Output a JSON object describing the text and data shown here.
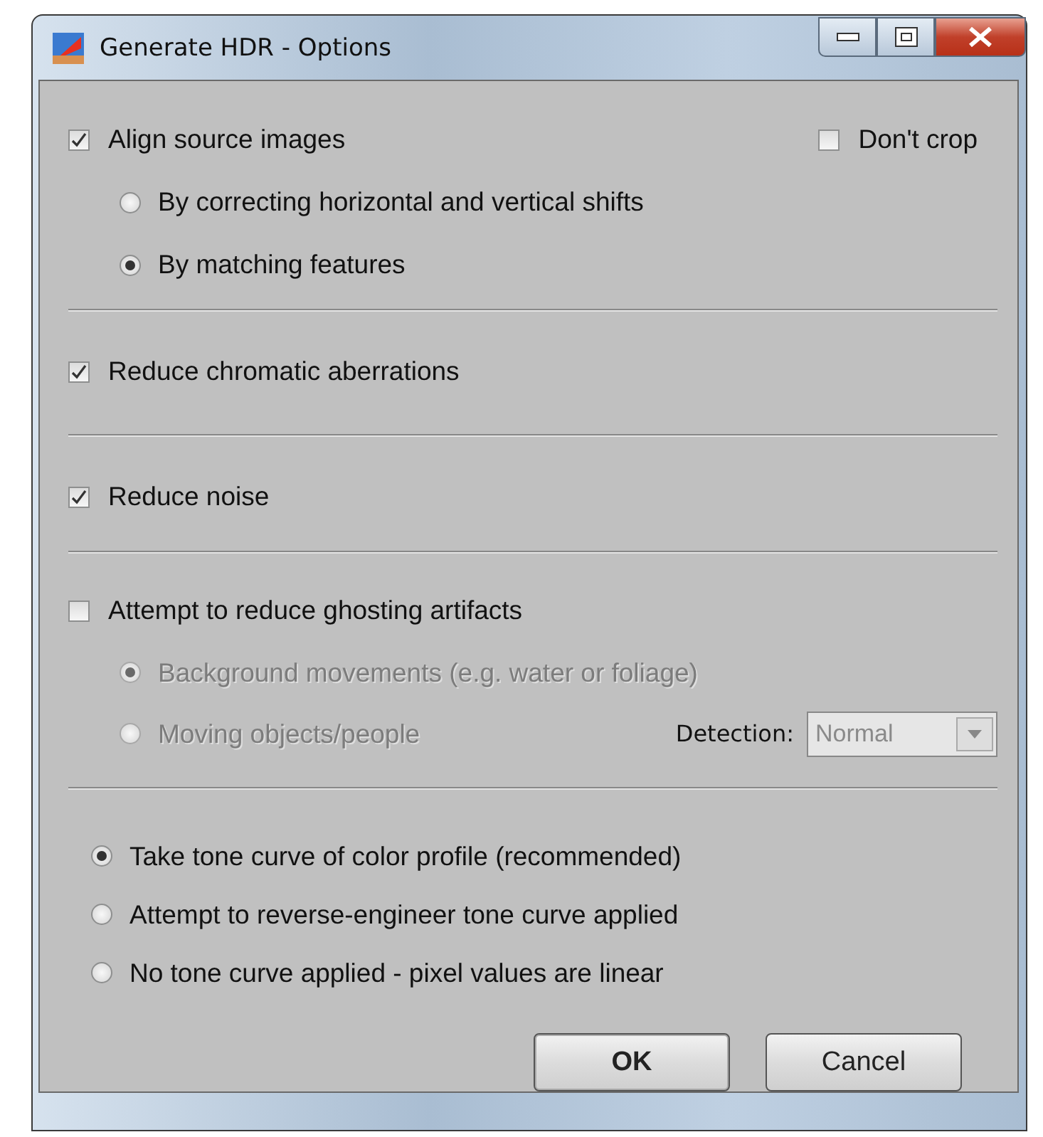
{
  "window": {
    "title": "Generate HDR - Options"
  },
  "align": {
    "label": "Align source images",
    "checked": true,
    "dont_crop": {
      "label": "Don't crop",
      "checked": false
    },
    "options": [
      {
        "label": "By correcting horizontal and vertical shifts",
        "selected": false,
        "disabled": false
      },
      {
        "label": "By matching features",
        "selected": true,
        "disabled": false
      }
    ]
  },
  "chromatic": {
    "label": "Reduce chromatic aberrations",
    "checked": true
  },
  "noise": {
    "label": "Reduce noise",
    "checked": true
  },
  "ghosting": {
    "label": "Attempt to reduce ghosting artifacts",
    "checked": false,
    "options": [
      {
        "label": "Background movements (e.g. water or foliage)",
        "selected": true,
        "disabled": true
      },
      {
        "label": "Moving objects/people",
        "selected": false,
        "disabled": true
      }
    ],
    "detection": {
      "label": "Detection:",
      "value": "Normal",
      "disabled": true
    }
  },
  "tone_curve": [
    {
      "label": "Take tone curve of color profile (recommended)",
      "selected": true
    },
    {
      "label": "Attempt to reverse-engineer tone curve applied",
      "selected": false
    },
    {
      "label": "No tone curve applied - pixel values are linear",
      "selected": false
    }
  ],
  "buttons": [
    {
      "label": "OK",
      "default": true
    },
    {
      "label": "Cancel",
      "default": false
    }
  ]
}
